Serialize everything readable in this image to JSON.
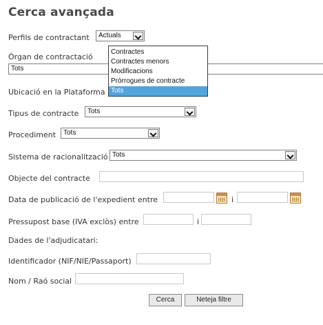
{
  "title": "Cerca avançada",
  "perfils": {
    "label": "Perfils de contractant",
    "value": "Actuals"
  },
  "organ": {
    "label": "Òrgan de contractació",
    "value": "Tots"
  },
  "dropdown_options": [
    "Contractes",
    "Contractes menors",
    "Modificacions",
    "Pròrrogues de contracte",
    "Tots"
  ],
  "dropdown_selected": "Tots",
  "ubicacio": {
    "label": "Ubicació en la Plataforma"
  },
  "tipus": {
    "label": "Tipus de contracte",
    "value": "Tots"
  },
  "procediment": {
    "label": "Procediment",
    "value": "Tots"
  },
  "sistema": {
    "label": "Sistema de racionalització",
    "value": "Tots"
  },
  "objecte": {
    "label": "Objecte del contracte",
    "value": ""
  },
  "data_publicacio": {
    "label": "Data de publicació de l'expedient entre",
    "separator": "i"
  },
  "pressupost": {
    "label": "Pressupost base (IVA exclòs) entre",
    "separator": "i"
  },
  "adjudicatari": {
    "heading": "Dades de l'adjudicatari:"
  },
  "identificador": {
    "label": "Identificador (NIF/NIE/Passaport)"
  },
  "nom": {
    "label": "Nom / Raó social"
  },
  "buttons": {
    "search": "Cerca",
    "clear": "Neteja filtre"
  },
  "icons": {
    "calendar": "calendar-icon",
    "dropdown": "chevron-down-icon"
  }
}
